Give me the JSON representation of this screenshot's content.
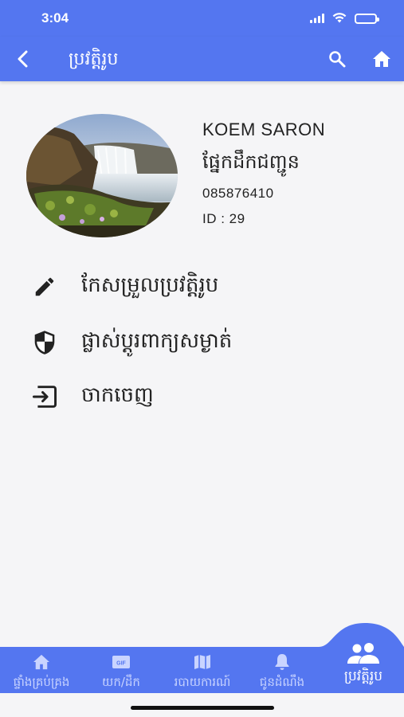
{
  "status_bar": {
    "time": "3:04"
  },
  "app_bar": {
    "title": "ប្រវត្តិរូប"
  },
  "profile": {
    "name": "KOEM SARON",
    "department": "ផ្នែកដឹកជញ្ជូន",
    "phone": "085876410",
    "id_label": "ID : 29"
  },
  "menu": [
    {
      "label": "កែសម្រួលប្រវត្តិរូប",
      "icon": "pencil-icon"
    },
    {
      "label": "ផ្លាស់ប្តូរពាក្យសម្ងាត់",
      "icon": "shield-icon"
    },
    {
      "label": "ចាកចេញ",
      "icon": "logout-icon"
    }
  ],
  "bottom_nav": [
    {
      "label": "ផ្ទាំងគ្រប់គ្រង",
      "icon": "home-icon",
      "active": false
    },
    {
      "label": "យក/ដឹក",
      "icon": "gif-icon",
      "active": false
    },
    {
      "label": "របាយការណ៍",
      "icon": "map-icon",
      "active": false
    },
    {
      "label": "ជូនដំណឹង",
      "icon": "bell-icon",
      "active": false
    },
    {
      "label": "ប្រវត្តិរូប",
      "icon": "people-icon",
      "active": true
    }
  ],
  "colors": {
    "primary": "#5476f0",
    "nav_active_bg": "#5476f0"
  }
}
